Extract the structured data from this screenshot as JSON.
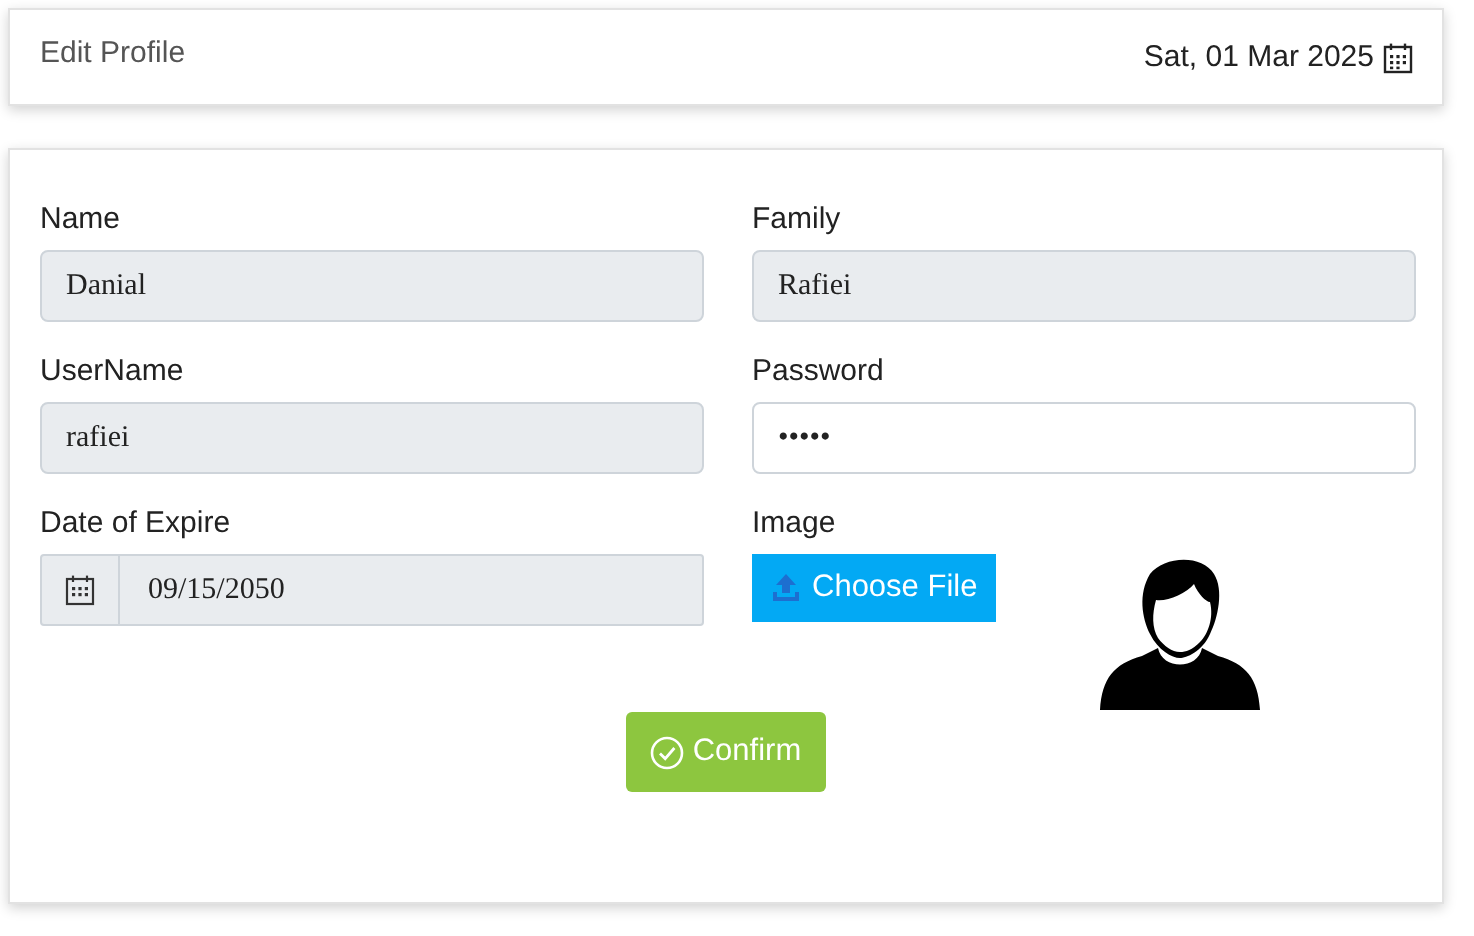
{
  "header": {
    "title": "Edit Profile",
    "date": "Sat, 01 Mar 2025"
  },
  "fields": [
    {
      "kind": "text",
      "label": "Name",
      "value": "Danial",
      "disabled": true
    },
    {
      "kind": "text",
      "label": "Family",
      "value": "Rafiei",
      "disabled": true
    },
    {
      "kind": "text",
      "label": "UserName",
      "value": "rafiei",
      "disabled": true
    },
    {
      "kind": "text",
      "label": "Password",
      "value": "•••••",
      "disabled": false
    },
    {
      "kind": "date",
      "label": "Date of Expire",
      "value": "09/15/2050",
      "disabled": true
    },
    {
      "kind": "file",
      "label": "Image",
      "button": "Choose File"
    }
  ],
  "confirm": "Confirm"
}
